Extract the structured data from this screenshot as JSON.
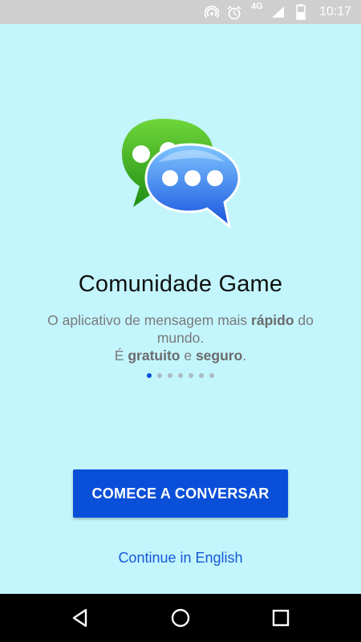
{
  "status_bar": {
    "network_label": "4G",
    "time": "10:17",
    "icons": [
      "hotspot-icon",
      "alarm-icon",
      "signal-icon",
      "battery-icon"
    ]
  },
  "app": {
    "title": "Comunidade Game",
    "subtitle": {
      "line1_prefix": "O aplicativo de mensagem mais ",
      "line1_bold": "rápido",
      "line1_suffix": " do mundo.",
      "line2_prefix": "É ",
      "line2_bold1": "gratuito",
      "line2_mid": " e ",
      "line2_bold2": "seguro",
      "line2_suffix": "."
    },
    "pagination": {
      "total": 7,
      "active_index": 0
    },
    "primary_button": "COMECE A CONVERSAR",
    "secondary_link": "Continue in English",
    "logo_icon": "chat-bubbles-logo-icon"
  },
  "nav_bar": {
    "icons": [
      "back-icon",
      "home-icon",
      "recents-icon"
    ]
  },
  "colors": {
    "background": "#c3f5fd",
    "accent": "#0a4fd8",
    "link": "#1559d6",
    "status_bar": "#cfcfcf",
    "nav_bar": "#000000"
  }
}
